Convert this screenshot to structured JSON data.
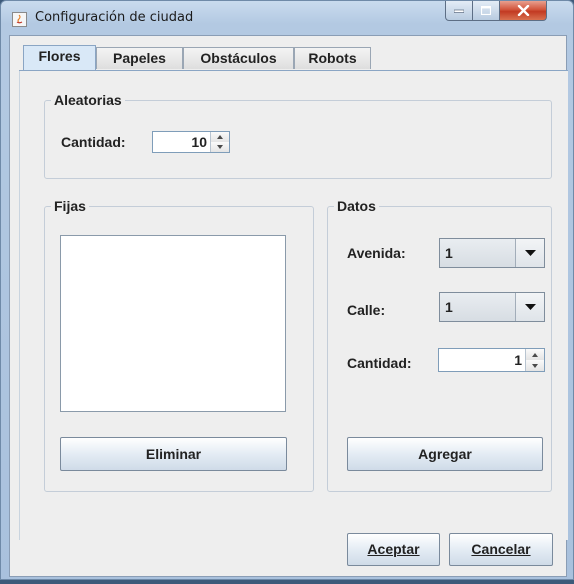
{
  "window": {
    "title": "Configuración de ciudad",
    "minimize_glyph": "–",
    "maximize_glyph": "□",
    "close_glyph": "X"
  },
  "tabs": [
    {
      "label": "Flores",
      "active": true
    },
    {
      "label": "Papeles",
      "active": false
    },
    {
      "label": "Obstáculos",
      "active": false
    },
    {
      "label": "Robots",
      "active": false
    }
  ],
  "aleatorias": {
    "title": "Aleatorias",
    "cantidad_label": "Cantidad:",
    "cantidad_value": "10"
  },
  "fijas": {
    "title": "Fijas",
    "items": [],
    "eliminar_label": "Eliminar"
  },
  "datos": {
    "title": "Datos",
    "avenida_label": "Avenida:",
    "avenida_value": "1",
    "calle_label": "Calle:",
    "calle_value": "1",
    "cantidad_label": "Cantidad:",
    "cantidad_value": "1",
    "agregar_label": "Agregar"
  },
  "footer": {
    "aceptar_label": "Aceptar",
    "cancelar_label": "Cancelar"
  },
  "colors": {
    "active_tab": "#d9e8f7",
    "close_button": "#c23a22",
    "panel_background": "#eeeeee"
  }
}
